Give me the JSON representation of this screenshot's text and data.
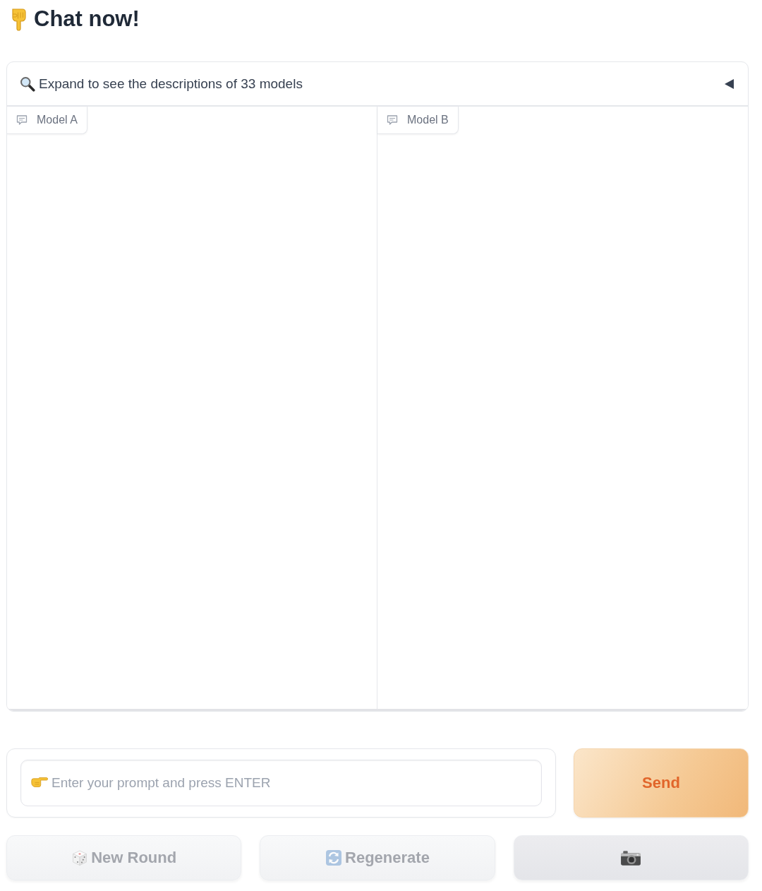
{
  "title": {
    "text": "Chat now!"
  },
  "models_accordion": {
    "label": "Expand to see the descriptions of 33 models",
    "expanded": false
  },
  "chatbots": [
    {
      "label": "Model A"
    },
    {
      "label": "Model B"
    }
  ],
  "prompt": {
    "placeholder": "Enter your prompt and press ENTER"
  },
  "send_button": {
    "label": "Send"
  },
  "buttons": [
    {
      "label": "New Round",
      "disabled": true
    },
    {
      "label": "Regenerate",
      "disabled": true
    },
    {
      "disabled": true
    }
  ]
}
